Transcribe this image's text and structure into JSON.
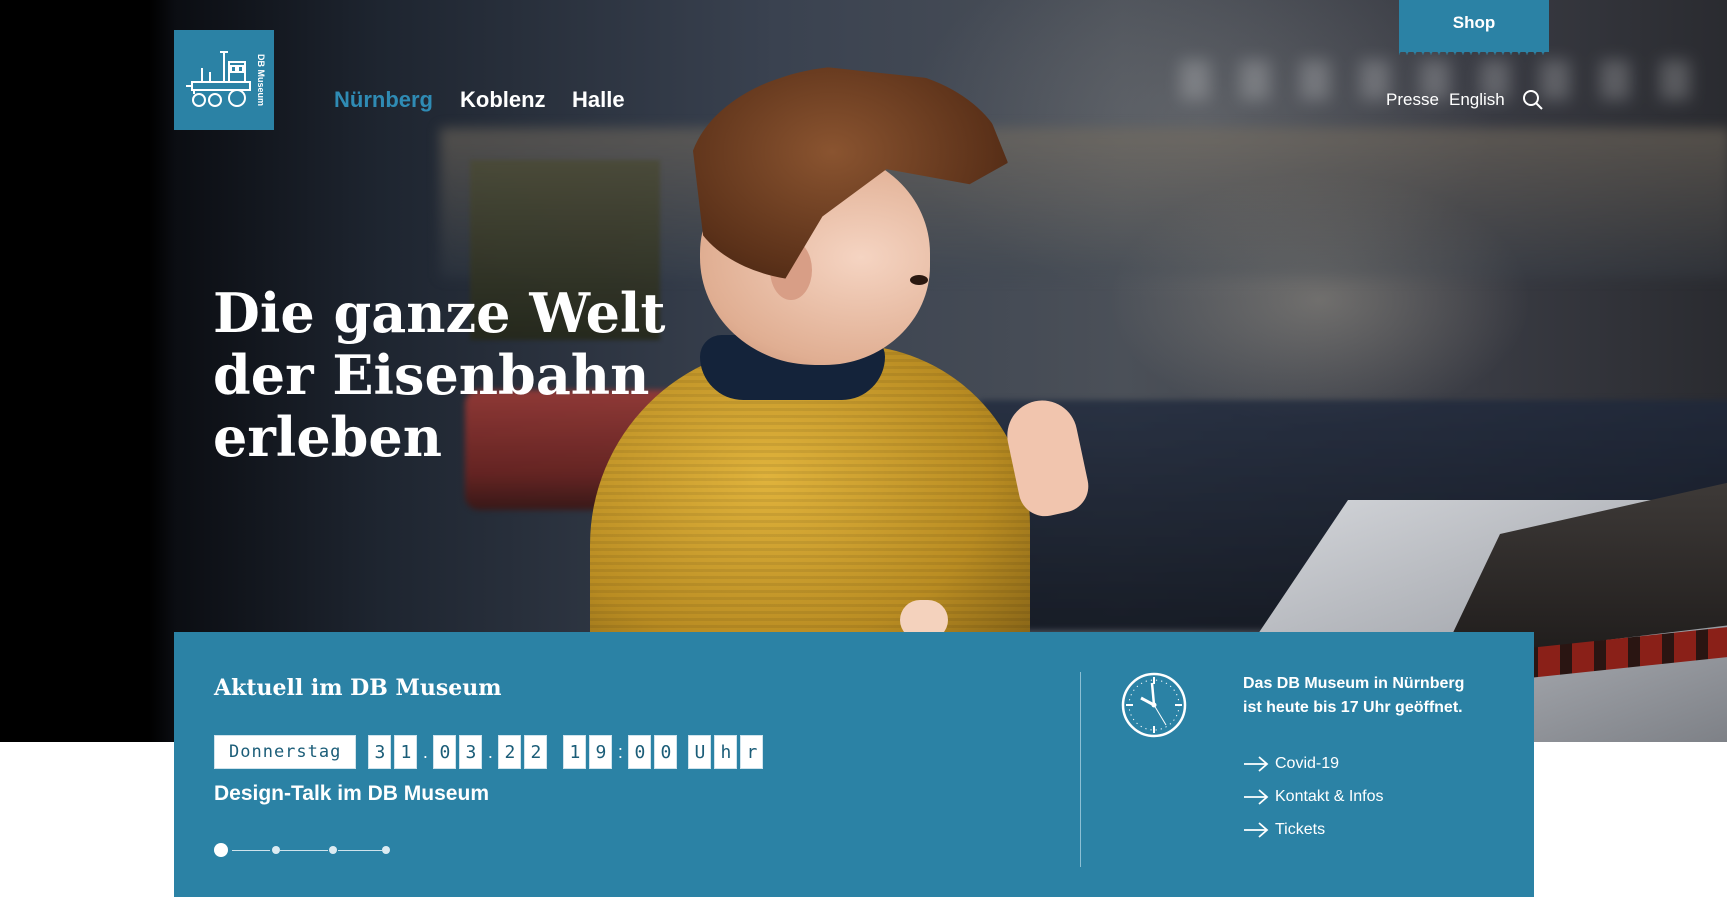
{
  "header": {
    "logo_text": "DB Museum",
    "nav_cities": [
      {
        "label": "Nürnberg",
        "active": true
      },
      {
        "label": "Koblenz",
        "active": false
      },
      {
        "label": "Halle",
        "active": false
      }
    ],
    "shop_label": "Shop",
    "presse_label": "Presse",
    "language_label": "English",
    "search_icon": "search-icon"
  },
  "hero": {
    "title_line1": "Die ganze Welt",
    "title_line2": "der Eisenbahn",
    "title_line3": "erleben"
  },
  "panel": {
    "title": "Aktuell im DB Museum",
    "event": {
      "day": "Donnerstag",
      "date_digits": [
        "3",
        "1",
        "0",
        "3",
        "2",
        "2"
      ],
      "time_digits": [
        "1",
        "9",
        "0",
        "0"
      ],
      "unit_letters": [
        "U",
        "h",
        "r"
      ],
      "title": "Design-Talk im DB Museum"
    },
    "slider": {
      "count": 4,
      "active_index": 0
    },
    "opening_text_line1": "Das DB Museum in Nürnberg",
    "opening_text_line2": "ist heute bis 17 Uhr geöffnet.",
    "clock_icon": "clock-icon",
    "links": [
      {
        "label": "Covid-19",
        "icon": "arrow-right-icon"
      },
      {
        "label": "Kontakt & Infos",
        "icon": "arrow-right-icon"
      },
      {
        "label": "Tickets",
        "icon": "arrow-right-icon"
      }
    ]
  },
  "colors": {
    "brand_blue": "#2b82a5",
    "active_nav": "#2f8bb4",
    "text_white": "#ffffff"
  }
}
